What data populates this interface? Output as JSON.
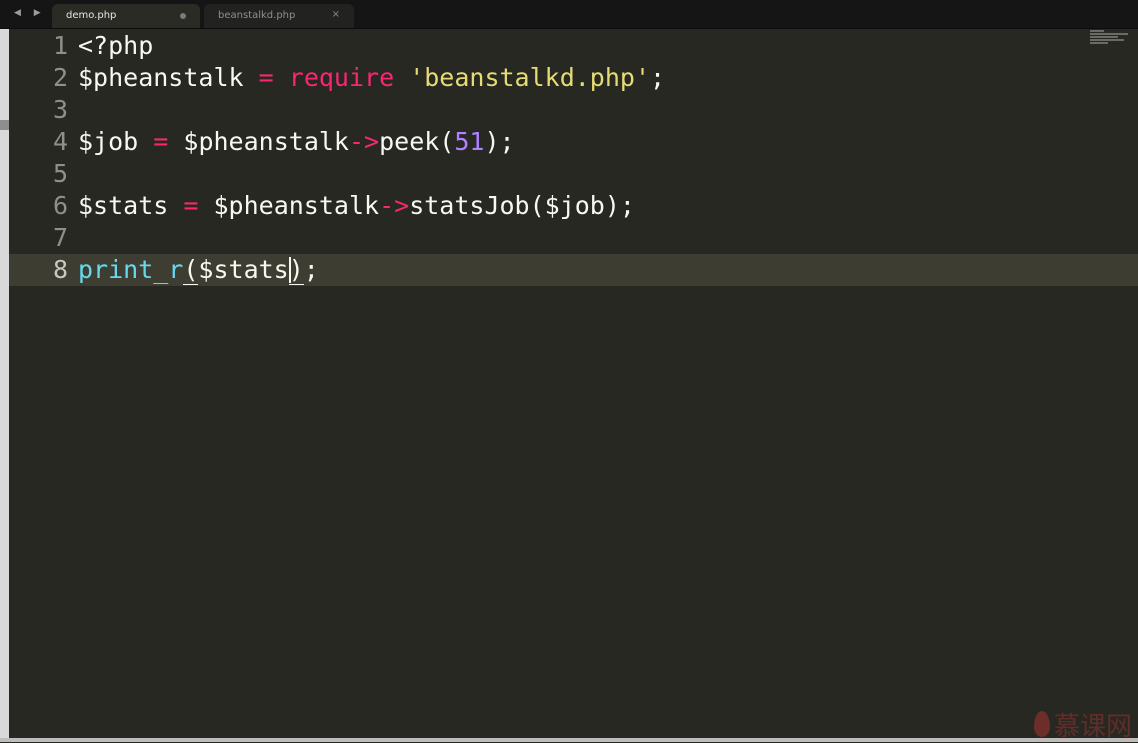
{
  "tabs": [
    {
      "label": "demo.php",
      "active": true,
      "modified": true
    },
    {
      "label": "beanstalkd.php",
      "active": false,
      "close_icon": "×"
    }
  ],
  "nav_arrows": "◀ ▶",
  "line_numbers": [
    "1",
    "2",
    "3",
    "4",
    "5",
    "6",
    "7",
    "8"
  ],
  "code": {
    "line1": {
      "open_tag": "<?php"
    },
    "line2": {
      "var": "$pheanstalk",
      "eq": "=",
      "kw": "require",
      "str": "'beanstalkd.php'",
      "end": ";"
    },
    "line4": {
      "var": "$job",
      "eq": "=",
      "obj": "$pheanstalk",
      "arrow": "->",
      "method": "peek(",
      "num": "51",
      "end": ");"
    },
    "line6": {
      "var": "$stats",
      "eq": "=",
      "obj": "$pheanstalk",
      "arrow": "->",
      "method": "statsJob($job);"
    },
    "line8": {
      "fn": "print_r",
      "open": "(",
      "arg": "$stats",
      "close": ")",
      "end": ";"
    }
  },
  "current_line": 8,
  "watermark": {
    "text": "慕课网",
    "icon": "flame-icon"
  },
  "colors": {
    "background": "#272822",
    "keyword": "#f92672",
    "string": "#e6db74",
    "number": "#ae81ff",
    "function": "#66d9ef"
  }
}
